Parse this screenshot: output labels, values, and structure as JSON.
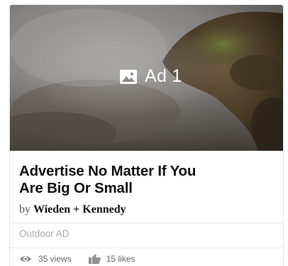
{
  "card": {
    "media": {
      "badge_icon": "image-icon",
      "badge_label": "Ad 1"
    },
    "title_line1": "Advertise No Matter If You",
    "title_line2": "Are Big Or Small",
    "byline": {
      "prefix": "by",
      "author": "Wieden + Kennedy"
    },
    "category": "Outdoor AD",
    "stats": {
      "views_icon": "eye-icon",
      "views": "35 views",
      "likes_icon": "thumbs-up-icon",
      "likes": "15 likes"
    }
  }
}
